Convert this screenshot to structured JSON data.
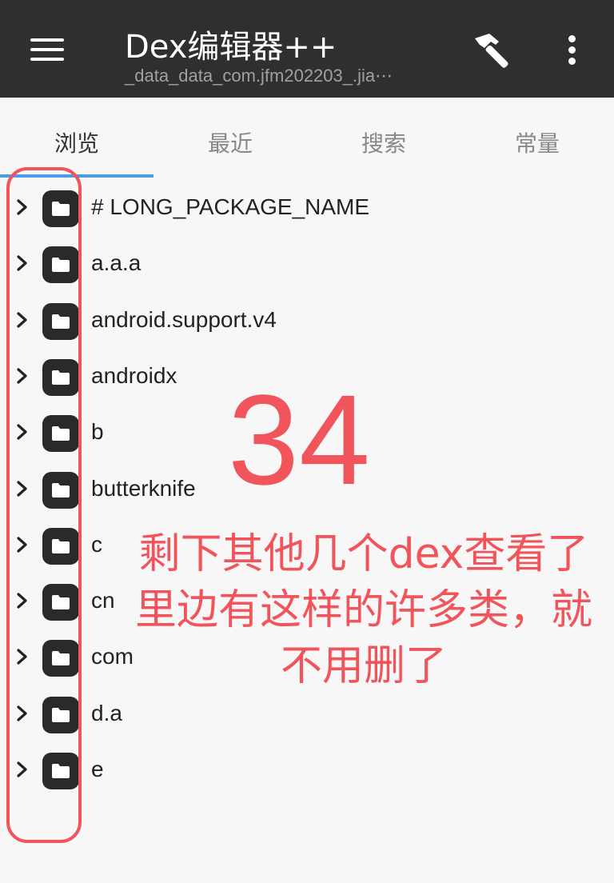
{
  "appbar": {
    "title": "Dex编辑器++",
    "subtitle": "_data_data_com.jfm202203_.jia⋯",
    "icons": {
      "menu": "hamburger-menu-icon",
      "build": "hammer-icon",
      "more": "more-vert-icon"
    }
  },
  "tabs": [
    {
      "label": "浏览",
      "active": true
    },
    {
      "label": "最近",
      "active": false
    },
    {
      "label": "搜索",
      "active": false
    },
    {
      "label": "常量",
      "active": false
    }
  ],
  "tree": {
    "items": [
      {
        "label": "# LONG_PACKAGE_NAME"
      },
      {
        "label": "a.a.a"
      },
      {
        "label": "android.support.v4"
      },
      {
        "label": "androidx"
      },
      {
        "label": "b"
      },
      {
        "label": "butterknife"
      },
      {
        "label": "c"
      },
      {
        "label": "cn"
      },
      {
        "label": "com"
      },
      {
        "label": "d.a"
      },
      {
        "label": "e"
      }
    ]
  },
  "annotation": {
    "number": "34",
    "text": "剩下其他几个dex查看了里边有这样的许多类，就不用删了",
    "color": "#f2545b"
  },
  "colors": {
    "appbar": "#2f2f2f",
    "tab_indicator": "#4a9fe0",
    "background": "#f7f7f7"
  }
}
